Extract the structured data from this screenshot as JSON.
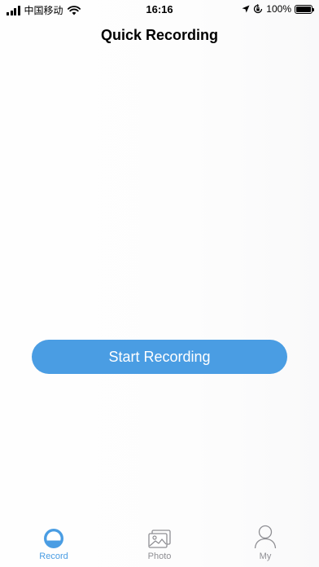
{
  "status_bar": {
    "carrier": "中国移动",
    "time": "16:16",
    "battery": "100%",
    "icons": [
      "signal-icon",
      "wifi-icon",
      "location-icon",
      "rotation-lock-icon",
      "battery-icon"
    ]
  },
  "nav": {
    "title": "Quick Recording"
  },
  "main": {
    "start_button_label": "Start Recording"
  },
  "tab_bar": {
    "active": "Record",
    "tabs": [
      {
        "label": "Record",
        "icon": "record-icon"
      },
      {
        "label": "Photo",
        "icon": "photo-icon"
      },
      {
        "label": "My",
        "icon": "person-icon"
      }
    ]
  },
  "colors": {
    "accent": "#4a9de3",
    "inactive": "#8e8e93"
  }
}
